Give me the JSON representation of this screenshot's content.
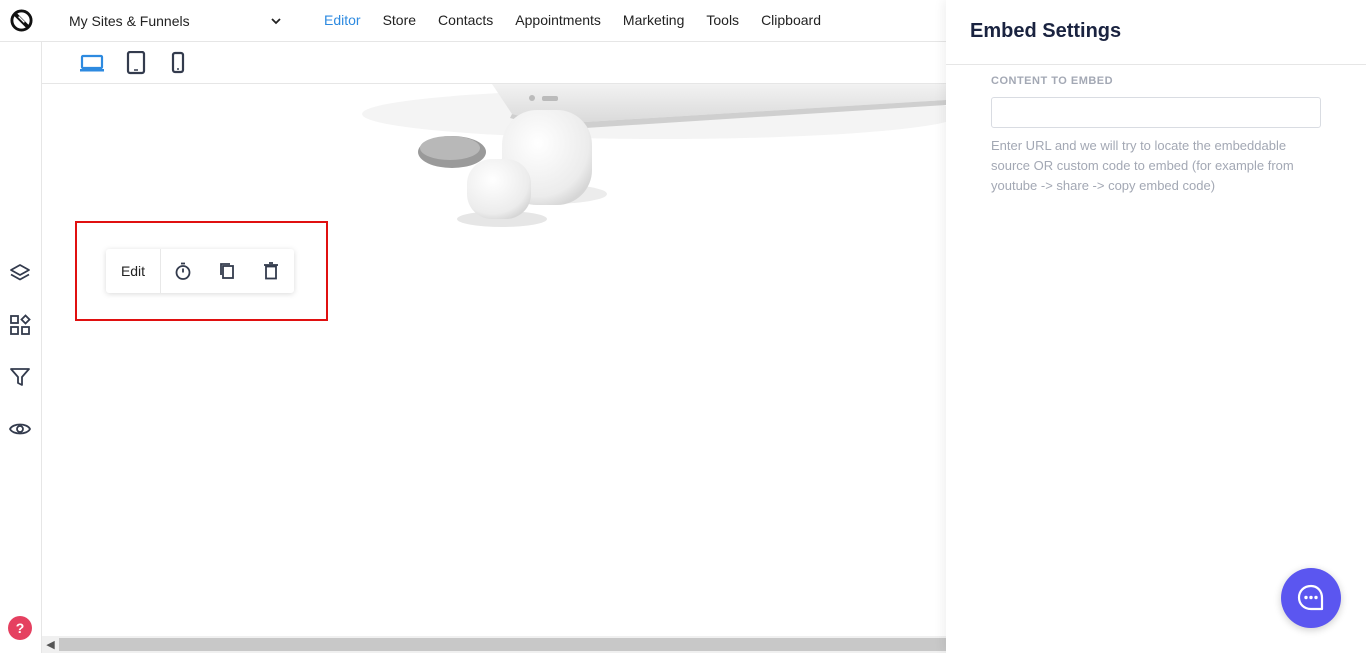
{
  "topbar": {
    "site_select": "My Sites & Funnels",
    "nav": [
      "Editor",
      "Store",
      "Contacts",
      "Appointments",
      "Marketing",
      "Tools",
      "Clipboard"
    ],
    "active_nav": "Editor"
  },
  "element_toolbar": {
    "edit_label": "Edit"
  },
  "panel": {
    "title": "Embed Settings",
    "field_label": "CONTENT TO EMBED",
    "input_value": "",
    "help_text": "Enter URL and we will try to locate the embeddable source OR custom code to embed (for example from youtube -> share -> copy embed code)"
  },
  "help_badge": "?",
  "colors": {
    "accent": "#2d8ae0",
    "selection_border": "#e01010",
    "chat_bubble": "#5b56f0",
    "help_badge": "#e54060"
  },
  "icons": {
    "sidebar": [
      "layers-icon",
      "widgets-icon",
      "filter-icon",
      "eye-icon"
    ],
    "devices": [
      "desktop-icon",
      "tablet-icon",
      "mobile-icon"
    ],
    "toolbar": [
      "timer-icon",
      "copy-icon",
      "trash-icon"
    ]
  }
}
